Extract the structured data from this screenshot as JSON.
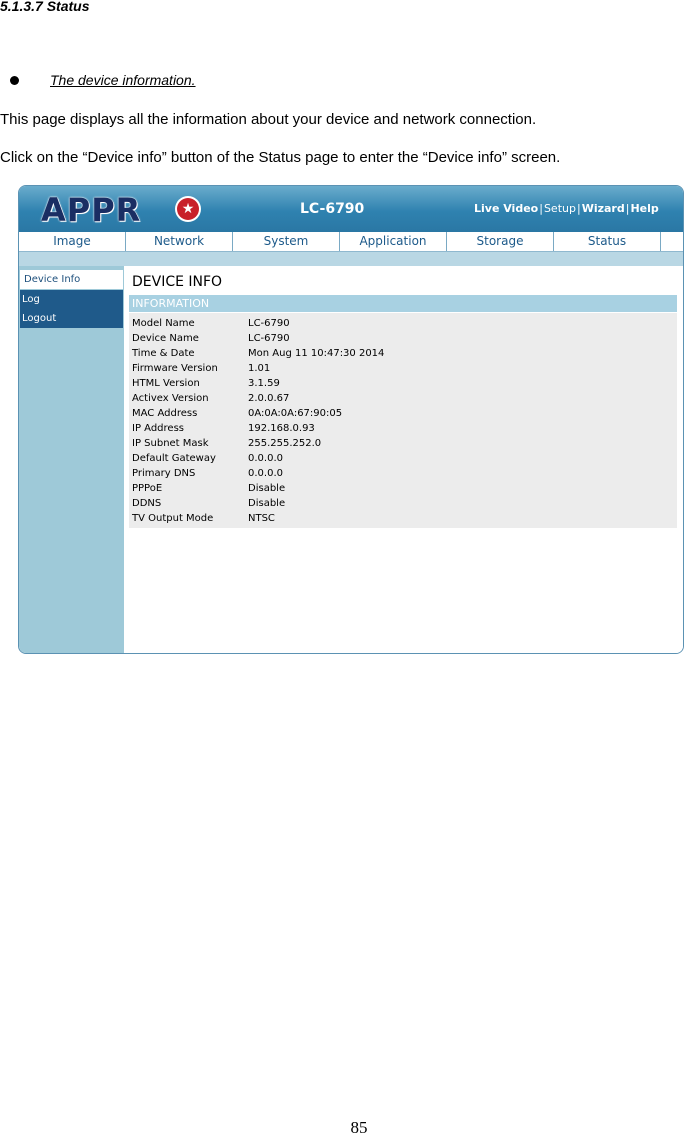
{
  "doc": {
    "heading": "5.1.3.7 Status",
    "bullet": "The device information.",
    "para1": "This page displays all the information about your device and network connection.",
    "para2": "Click on the “Device info” button of the Status page to enter the “Device info” screen.",
    "page_number": "85"
  },
  "app": {
    "logo_text": "APPR",
    "logo_star": "★",
    "model": "LC-6790",
    "top_links": [
      "Live Video",
      "Setup",
      "Wizard",
      "Help"
    ],
    "nav_tabs": [
      "Image",
      "Network",
      "System",
      "Application",
      "Storage",
      "Status"
    ],
    "sidebar": [
      "Device Info",
      "Log",
      "Logout"
    ],
    "page_title": "DEVICE INFO",
    "section_title": "INFORMATION",
    "info": [
      {
        "label": "Model Name",
        "value": "LC-6790"
      },
      {
        "label": "Device Name",
        "value": "LC-6790"
      },
      {
        "label": "Time & Date",
        "value": "Mon Aug 11 10:47:30 2014"
      },
      {
        "label": "Firmware Version",
        "value": "1.01"
      },
      {
        "label": "HTML Version",
        "value": "3.1.59"
      },
      {
        "label": "Activex Version",
        "value": "2.0.0.67"
      },
      {
        "label": "MAC Address",
        "value": "0A:0A:0A:67:90:05"
      },
      {
        "label": "IP Address",
        "value": "192.168.0.93"
      },
      {
        "label": "IP Subnet Mask",
        "value": "255.255.252.0"
      },
      {
        "label": "Default Gateway",
        "value": "0.0.0.0"
      },
      {
        "label": "Primary DNS",
        "value": "0.0.0.0"
      },
      {
        "label": "PPPoE",
        "value": "Disable"
      },
      {
        "label": "DDNS",
        "value": "Disable"
      },
      {
        "label": "TV Output Mode",
        "value": "NTSC"
      }
    ],
    "colors": {
      "banner": "#2f82b0",
      "sidebar": "#9ec9d8",
      "sidebar_item": "#1f5a8a",
      "section_bar": "#a8d1e2"
    }
  }
}
